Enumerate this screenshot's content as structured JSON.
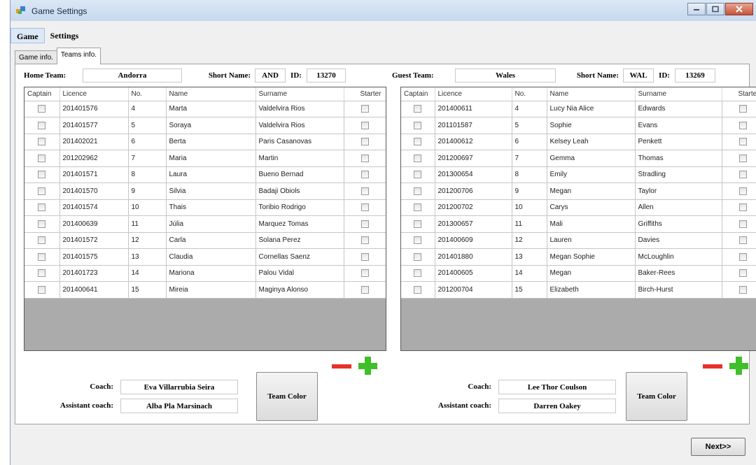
{
  "window": {
    "title": "Game Settings"
  },
  "menu": [
    "Game",
    "Settings"
  ],
  "tabs": [
    "Game info.",
    "Teams info."
  ],
  "columns": [
    "Captain",
    "Licence",
    "No.",
    "Name",
    "Surname",
    "Starter"
  ],
  "home": {
    "team_label": "Home Team:",
    "team": "Andorra",
    "short_label": "Short Name:",
    "short": "AND",
    "id_label": "ID:",
    "id": "13270",
    "players": [
      {
        "licence": "201401576",
        "no": "4",
        "name": "Marta",
        "surname": "Valdelvira Rios"
      },
      {
        "licence": "201401577",
        "no": "5",
        "name": "Soraya",
        "surname": "Valdelvira Rios"
      },
      {
        "licence": "201402021",
        "no": "6",
        "name": "Berta",
        "surname": "Paris Casanovas"
      },
      {
        "licence": "201202962",
        "no": "7",
        "name": "Maria",
        "surname": "Martin"
      },
      {
        "licence": "201401571",
        "no": "8",
        "name": "Laura",
        "surname": "Bueno Bernad"
      },
      {
        "licence": "201401570",
        "no": "9",
        "name": "Silvia",
        "surname": "Badaji Obiols"
      },
      {
        "licence": "201401574",
        "no": "10",
        "name": "Thais",
        "surname": "Toribio Rodrigo"
      },
      {
        "licence": "201400639",
        "no": "11",
        "name": "Júlia",
        "surname": "Marquez Tomas"
      },
      {
        "licence": "201401572",
        "no": "12",
        "name": "Carla",
        "surname": "Solana Perez"
      },
      {
        "licence": "201401575",
        "no": "13",
        "name": "Claudia",
        "surname": "Cornellas Saenz"
      },
      {
        "licence": "201401723",
        "no": "14",
        "name": "Mariona",
        "surname": "Palou Vidal"
      },
      {
        "licence": "201400641",
        "no": "15",
        "name": "Mireia",
        "surname": "Maginya Alonso"
      }
    ],
    "coach_label": "Coach:",
    "coach": "Eva Villarrubia Seira",
    "assistant_label": "Assistant coach:",
    "assistant": "Alba Pla Marsinach",
    "color_button": "Team Color"
  },
  "guest": {
    "team_label": "Guest Team:",
    "team": "Wales",
    "short_label": "Short Name:",
    "short": "WAL",
    "id_label": "ID:",
    "id": "13269",
    "players": [
      {
        "licence": "201400611",
        "no": "4",
        "name": "Lucy Nia Alice",
        "surname": "Edwards"
      },
      {
        "licence": "201101587",
        "no": "5",
        "name": "Sophie",
        "surname": "Evans"
      },
      {
        "licence": "201400612",
        "no": "6",
        "name": "Kelsey Leah",
        "surname": "Penkett"
      },
      {
        "licence": "201200697",
        "no": "7",
        "name": "Gemma",
        "surname": "Thomas"
      },
      {
        "licence": "201300654",
        "no": "8",
        "name": "Emily",
        "surname": "Stradling"
      },
      {
        "licence": "201200706",
        "no": "9",
        "name": "Megan",
        "surname": "Taylor"
      },
      {
        "licence": "201200702",
        "no": "10",
        "name": "Carys",
        "surname": "Allen"
      },
      {
        "licence": "201300657",
        "no": "11",
        "name": "Mali",
        "surname": "Griffiths"
      },
      {
        "licence": "201400609",
        "no": "12",
        "name": "Lauren",
        "surname": "Davies"
      },
      {
        "licence": "201401880",
        "no": "13",
        "name": "Megan Sophie",
        "surname": "McLoughlin"
      },
      {
        "licence": "201400605",
        "no": "14",
        "name": "Megan",
        "surname": "Baker-Rees"
      },
      {
        "licence": "201200704",
        "no": "15",
        "name": "Elizabeth",
        "surname": "Birch-Hurst"
      }
    ],
    "coach_label": "Coach:",
    "coach": "Lee Thor Coulson",
    "assistant_label": "Assistant coach:",
    "assistant": "Darren Oakey",
    "color_button": "Team Color"
  },
  "next_button": "Next>>",
  "colors": {
    "minus": "#e8312a",
    "plus": "#3fbf2a",
    "grid_empty": "#ababab"
  }
}
